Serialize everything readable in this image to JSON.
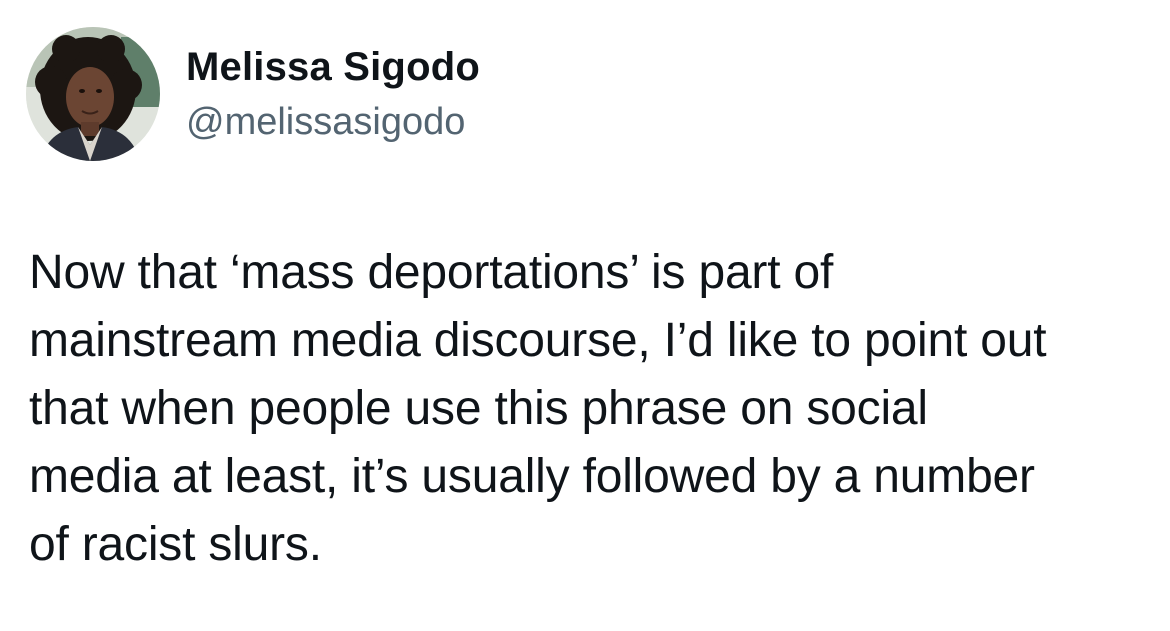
{
  "author": {
    "display_name": "Melissa Sigodo",
    "handle": "@melissasigodo",
    "avatar_icon": "profile-photo"
  },
  "tweet": {
    "text": "Now that ‘mass deportations’ is part of\nmainstream media discourse, I’d like to point out\nthat when people use this phrase on social\nmedia at least, it’s usually followed by a number\nof racist slurs."
  },
  "colors": {
    "text_primary": "#0f1419",
    "text_secondary": "#536471",
    "background": "#ffffff"
  }
}
